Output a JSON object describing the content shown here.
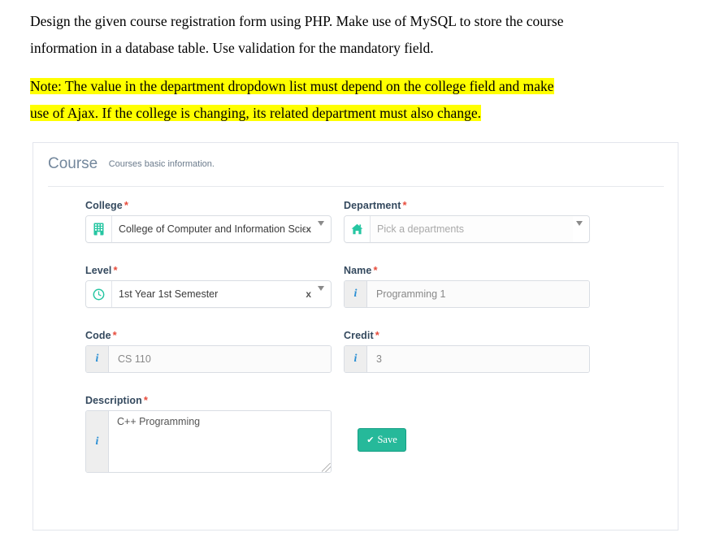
{
  "prompt": {
    "line1": "Design the given course registration form using PHP. Make use of MySQL to store the course",
    "line2": "information in a database table. Use validation for the mandatory field."
  },
  "note": {
    "line1": "Note: The value in the department dropdown list must depend on the college field and make",
    "line2": "use of Ajax. If the college is changing, its related department must also change.",
    "highlight_color": "#ffff00"
  },
  "card": {
    "title": "Course",
    "subtitle": "Courses basic information.",
    "title_color": "#73879c"
  },
  "form": {
    "required_marker": "*",
    "label_color": "#34495e",
    "accent_green": "#26b99a",
    "info_icon_color": "#2a8fd4",
    "fields": {
      "college": {
        "label": "College",
        "icon": "building-icon",
        "value": "College of Computer and Information Sciences",
        "clear": "x",
        "required": true
      },
      "department": {
        "label": "Department",
        "icon": "home-icon",
        "placeholder": "Pick a departments",
        "value": "",
        "required": true
      },
      "level": {
        "label": "Level",
        "icon": "clock-icon",
        "value": "1st Year 1st Semester",
        "clear": "x",
        "required": true
      },
      "name": {
        "label": "Name",
        "icon": "info-icon",
        "placeholder": "Programming 1",
        "value": "",
        "required": true
      },
      "code": {
        "label": "Code",
        "icon": "info-icon",
        "placeholder": "CS 110",
        "value": "",
        "required": true
      },
      "credit": {
        "label": "Credit",
        "icon": "info-icon",
        "placeholder": "3",
        "value": "",
        "required": true
      },
      "description": {
        "label": "Description",
        "icon": "info-icon",
        "value": "C++ Programming",
        "required": true
      }
    },
    "save": {
      "label": "Save",
      "icon": "check-icon",
      "glyph": "✔"
    }
  }
}
